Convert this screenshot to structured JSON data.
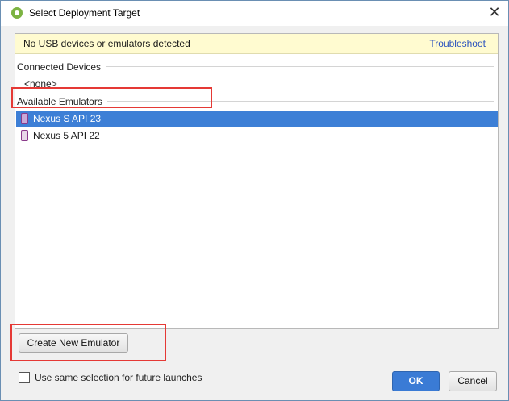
{
  "window": {
    "title": "Select Deployment Target",
    "close_glyph": "✕"
  },
  "notice": {
    "message": "No USB devices or emulators detected",
    "link_label": "Troubleshoot"
  },
  "connected_devices": {
    "header": "Connected Devices",
    "empty_label": "<none>"
  },
  "available_emulators": {
    "header": "Available Emulators",
    "items": [
      {
        "label": "Nexus S API 23",
        "icon": "phone-icon",
        "selected": true
      },
      {
        "label": "Nexus 5 API 22",
        "icon": "phone-icon",
        "selected": false
      }
    ]
  },
  "actions": {
    "create_label": "Create New Emulator",
    "remember_label": "Use same selection for future launches",
    "remember_checked": false,
    "ok_label": "OK",
    "cancel_label": "Cancel"
  },
  "colors": {
    "selection": "#3d7fd6",
    "notice_bg": "#fffbd0",
    "annotation": "#e53935"
  }
}
